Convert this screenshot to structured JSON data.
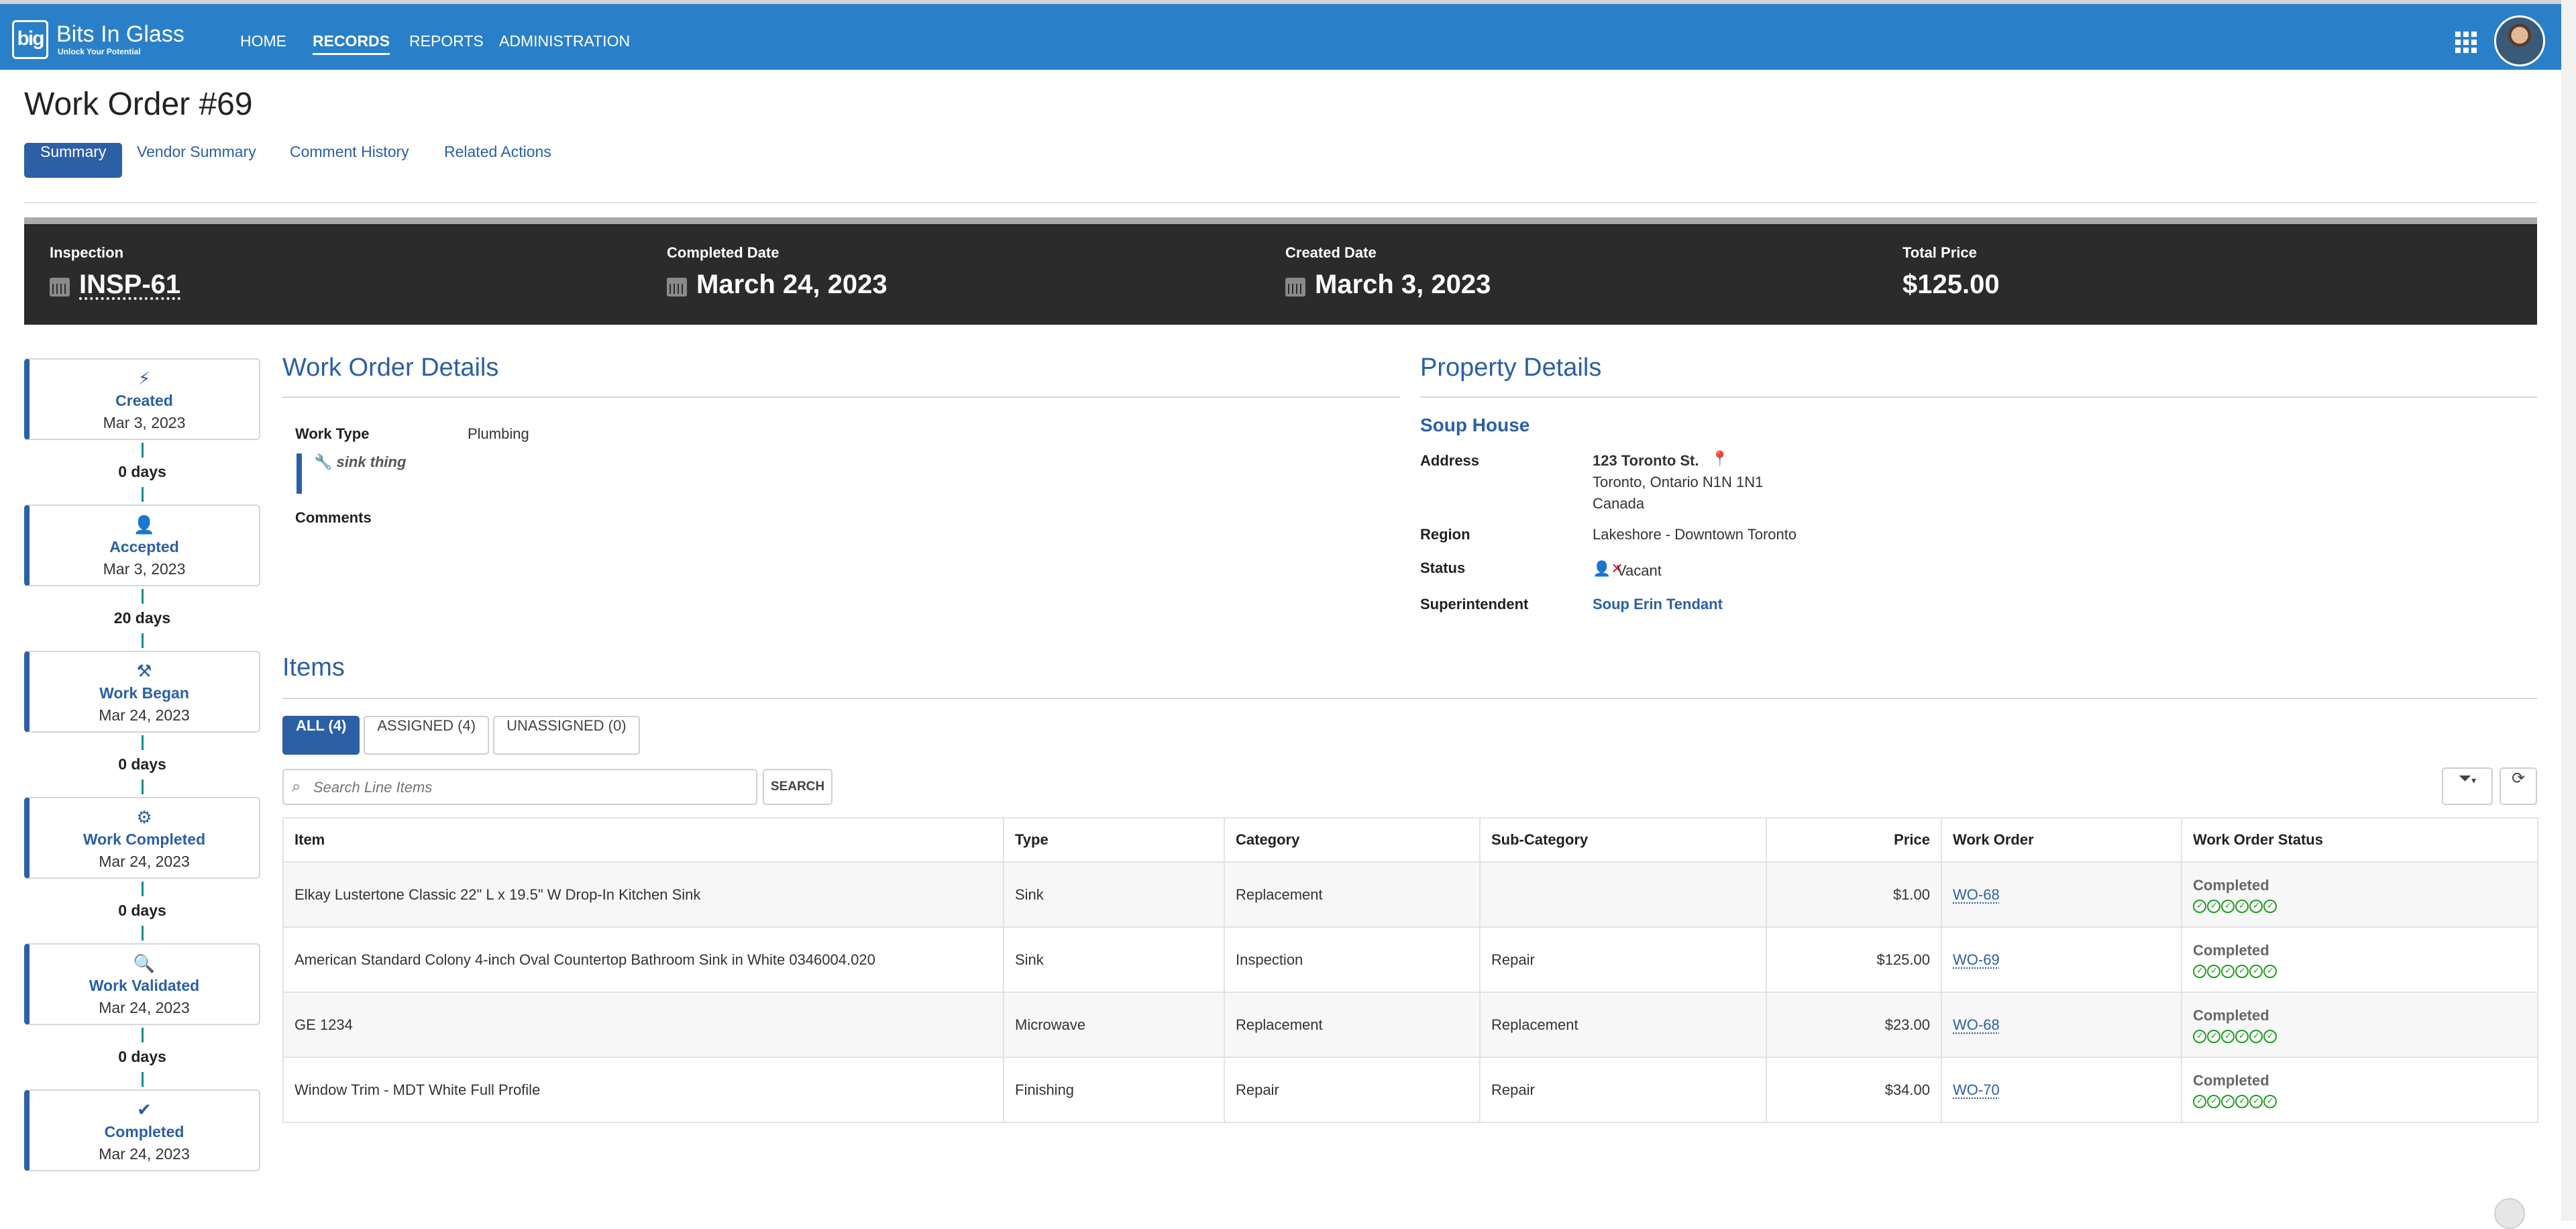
{
  "nav": {
    "logo_mark": "big",
    "brand": "Bits In Glass",
    "tagline": "Unlock Your Potential",
    "items": [
      {
        "label": "HOME"
      },
      {
        "label": "RECORDS"
      },
      {
        "label": "REPORTS"
      },
      {
        "label": "ADMINISTRATION"
      }
    ],
    "active": "RECORDS",
    "apps_icon": "grid-icon",
    "avatar_icon": "user-avatar"
  },
  "page": {
    "title": "Work Order #69",
    "tabs": [
      {
        "label": "Summary"
      },
      {
        "label": "Vendor Summary"
      },
      {
        "label": "Comment History"
      },
      {
        "label": "Related Actions"
      }
    ],
    "active_tab": "Summary"
  },
  "kpis": [
    {
      "label": "Inspection",
      "value": "INSP-61",
      "icon": "calendar-icon"
    },
    {
      "label": "Completed Date",
      "value": "March 24, 2023",
      "icon": "calendar-icon"
    },
    {
      "label": "Created Date",
      "value": "March 3, 2023",
      "icon": "calendar-icon"
    },
    {
      "label": "Total Price",
      "value": "$125.00"
    }
  ],
  "timeline": {
    "steps": [
      {
        "title": "Created",
        "date": "Mar 3, 2023",
        "icon": "bolt-icon"
      },
      {
        "title": "Accepted",
        "date": "Mar 3, 2023",
        "icon": "user-plus-icon"
      },
      {
        "title": "Work Began",
        "date": "Mar 24, 2023",
        "icon": "hammer-icon"
      },
      {
        "title": "Work Completed",
        "date": "Mar 24, 2023",
        "icon": "gears-icon"
      },
      {
        "title": "Work Validated",
        "date": "Mar 24, 2023",
        "icon": "search-icon"
      },
      {
        "title": "Completed",
        "date": "Mar 24, 2023",
        "icon": "check-icon"
      }
    ],
    "gaps": [
      "0 days",
      "20 days",
      "0 days",
      "0 days",
      "0 days"
    ]
  },
  "work_order_details": {
    "title": "Work Order Details",
    "work_type_label": "Work Type",
    "work_type": "Plumbing",
    "note": "sink thing",
    "comments_label": "Comments"
  },
  "property_details": {
    "title": "Property Details",
    "name": "Soup House",
    "address_label": "Address",
    "address_line1": "123 Toronto St.",
    "address_line2": "Toronto, Ontario N1N 1N1",
    "address_line3": "Canada",
    "region_label": "Region",
    "region": "Lakeshore - Downtown Toronto",
    "status_label": "Status",
    "status": "Vacant",
    "superintendent_label": "Superintendent",
    "superintendent": "Soup Erin Tendant"
  },
  "items": {
    "title": "Items",
    "filters": [
      {
        "label": "ALL (4)"
      },
      {
        "label": "ASSIGNED (4)"
      },
      {
        "label": "UNASSIGNED (0)"
      }
    ],
    "active_filter": "ALL (4)",
    "search_placeholder": "Search Line Items",
    "search_button": "SEARCH",
    "columns": [
      "Item",
      "Type",
      "Category",
      "Sub-Category",
      "Price",
      "Work Order",
      "Work Order Status"
    ],
    "rows": [
      {
        "item": "Elkay Lustertone Classic 22\" L x 19.5\" W Drop-In Kitchen Sink",
        "type": "Sink",
        "category": "Replacement",
        "subcategory": "",
        "price": "$1.00",
        "work_order": "WO-68",
        "status": "Completed"
      },
      {
        "item": "American Standard Colony 4-inch Oval Countertop Bathroom Sink in White 0346004.020",
        "type": "Sink",
        "category": "Inspection",
        "subcategory": "Repair",
        "price": "$125.00",
        "work_order": "WO-69",
        "status": "Completed"
      },
      {
        "item": "GE 1234",
        "type": "Microwave",
        "category": "Replacement",
        "subcategory": "Replacement",
        "price": "$23.00",
        "work_order": "WO-68",
        "status": "Completed"
      },
      {
        "item": "Window Trim - MDT White Full Profile",
        "type": "Finishing",
        "category": "Repair",
        "subcategory": "Repair",
        "price": "$34.00",
        "work_order": "WO-70",
        "status": "Completed"
      }
    ],
    "status_checks": 6
  },
  "colors": {
    "navbar": "#2a80c8",
    "accent": "#2b5fa6",
    "kpi_band": "#2b2b2b",
    "timeline_connector": "#1a8a8a",
    "check_green": "#1e9e1e",
    "status_red": "#d9233a"
  }
}
